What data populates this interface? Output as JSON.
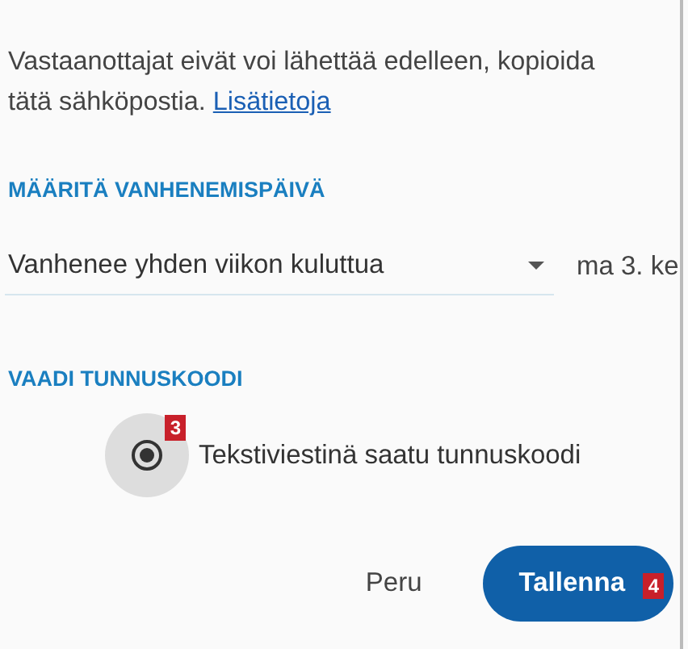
{
  "description": {
    "text": "Vastaanottajat eivät voi lähettää edelleen, kopioida",
    "text_2": "tätä sähköpostia.",
    "link": "Lisätietoja"
  },
  "expiry": {
    "heading": "MÄÄRITÄ VANHENEMISPÄIVÄ",
    "dropdown": {
      "value": "Vanhenee yhden viikon kuluttua"
    },
    "date": "ma 3. ke"
  },
  "passcode": {
    "heading": "VAADI TUNNUSKOODI",
    "options": [
      {
        "label": "Tekstiviestinä saatu tunnuskoodi",
        "selected": true,
        "badge": "3"
      }
    ]
  },
  "buttons": [
    {
      "label": "Peru",
      "kind": "text"
    },
    {
      "label": "Tallenna",
      "kind": "primary",
      "badge": "4"
    }
  ]
}
